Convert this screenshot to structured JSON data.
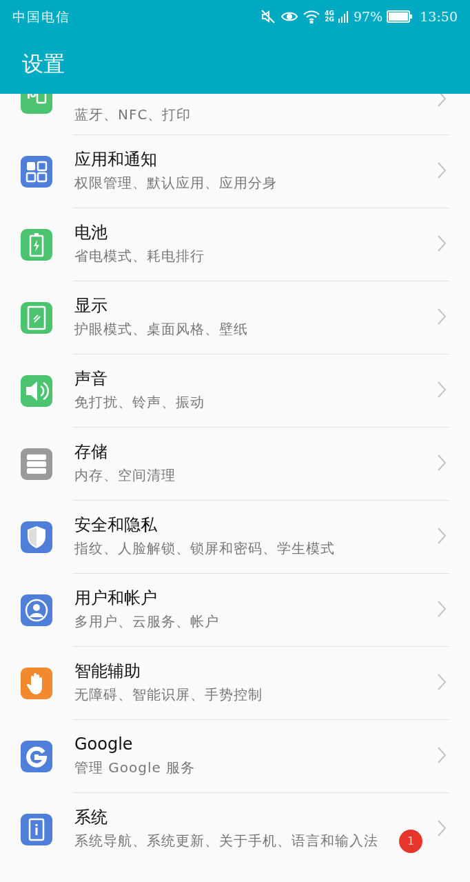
{
  "status_bar": {
    "carrier": "中国电信",
    "network_top": "4G",
    "network_bottom": "2G",
    "battery_text": "97%",
    "time": "13:50"
  },
  "app_bar": {
    "title": "设置"
  },
  "items": [
    {
      "kind": "partial",
      "subtitle": "蓝牙、NFC、打印",
      "color": "#4cc46f"
    },
    {
      "kind": "full",
      "title": "应用和通知",
      "subtitle": "权限管理、默认应用、应用分身",
      "color": "#4f7fd8"
    },
    {
      "kind": "full",
      "title": "电池",
      "subtitle": "省电模式、耗电排行",
      "color": "#4cc46f"
    },
    {
      "kind": "full",
      "title": "显示",
      "subtitle": "护眼模式、桌面风格、壁纸",
      "color": "#4cc46f"
    },
    {
      "kind": "full",
      "title": "声音",
      "subtitle": "免打扰、铃声、振动",
      "color": "#4cc46f"
    },
    {
      "kind": "full",
      "title": "存储",
      "subtitle": "内存、空间清理",
      "color": "#9a9a9a"
    },
    {
      "kind": "full",
      "title": "安全和隐私",
      "subtitle": "指纹、人脸解锁、锁屏和密码、学生模式",
      "color": "#4f7fd8"
    },
    {
      "kind": "full",
      "title": "用户和帐户",
      "subtitle": "多用户、云服务、帐户",
      "color": "#4f7fd8"
    },
    {
      "kind": "full",
      "title": "智能辅助",
      "subtitle": "无障碍、智能识屏、手势控制",
      "color": "#f08a2c"
    },
    {
      "kind": "full",
      "title": "Google",
      "subtitle": "管理 Google 服务",
      "color": "#4f7fd8"
    },
    {
      "kind": "full",
      "title": "系统",
      "subtitle": "系统导航、系统更新、关于手机、语言和输入法",
      "color": "#4f7fd8",
      "badge": "1"
    }
  ]
}
